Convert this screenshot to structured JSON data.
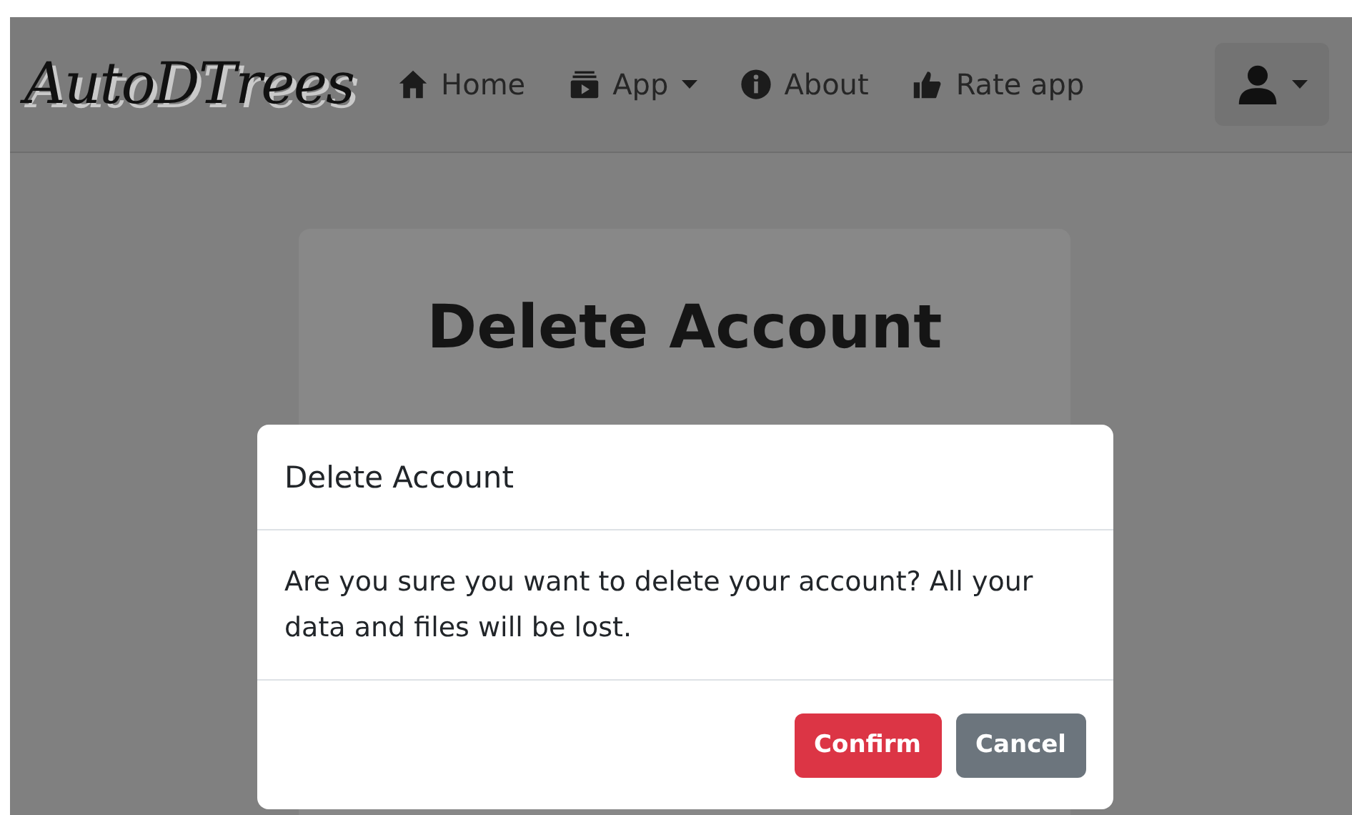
{
  "navbar": {
    "brand": "AutoDTrees",
    "items": [
      {
        "label": "Home",
        "dropdown": false
      },
      {
        "label": "App",
        "dropdown": true
      },
      {
        "label": "About",
        "dropdown": false
      },
      {
        "label": "Rate app",
        "dropdown": false
      }
    ],
    "user_menu": {
      "dropdown": true
    }
  },
  "card": {
    "title": "Delete Account"
  },
  "modal": {
    "title": "Delete Account",
    "body": "Are you sure you want to delete your account? All your data and files will be lost.",
    "buttons": [
      {
        "label": "Confirm",
        "kind": "danger"
      },
      {
        "label": "Cancel",
        "kind": "secondary"
      }
    ]
  }
}
